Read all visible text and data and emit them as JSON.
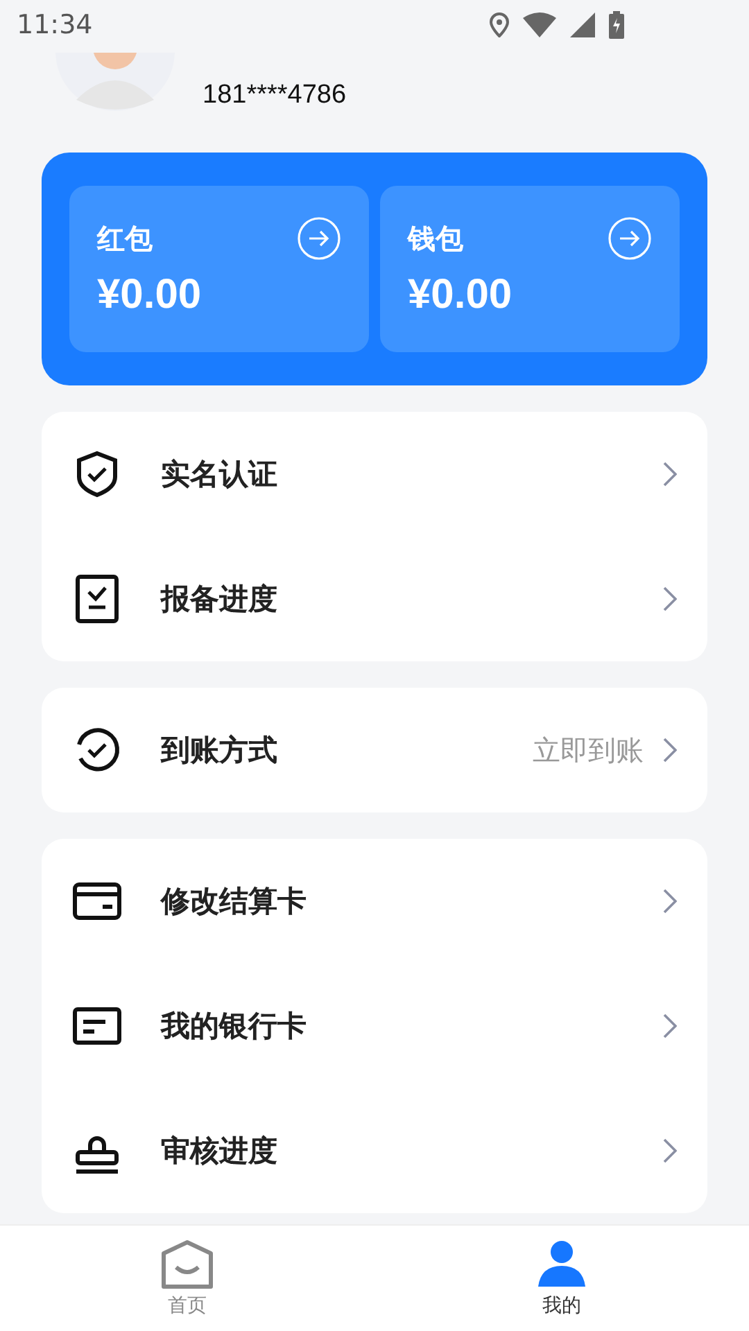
{
  "status_bar": {
    "time": "11:34"
  },
  "profile": {
    "phone": "181****4786"
  },
  "balances": [
    {
      "label": "红包",
      "amount": "¥0.00"
    },
    {
      "label": "钱包",
      "amount": "¥0.00"
    }
  ],
  "menu_groups": [
    {
      "items": [
        {
          "kind": "shield",
          "label": "实名认证"
        },
        {
          "kind": "clipboard",
          "label": "报备进度"
        }
      ]
    },
    {
      "items": [
        {
          "kind": "cycle",
          "label": "到账方式",
          "value": "立即到账"
        }
      ]
    },
    {
      "items": [
        {
          "kind": "card",
          "label": "修改结算卡"
        },
        {
          "kind": "bankcard",
          "label": "我的银行卡"
        },
        {
          "kind": "stamp",
          "label": "审核进度"
        }
      ]
    }
  ],
  "tab_bar": [
    {
      "kind": "home",
      "label": "首页",
      "selected": false
    },
    {
      "kind": "person",
      "label": "我的",
      "selected": true
    }
  ]
}
